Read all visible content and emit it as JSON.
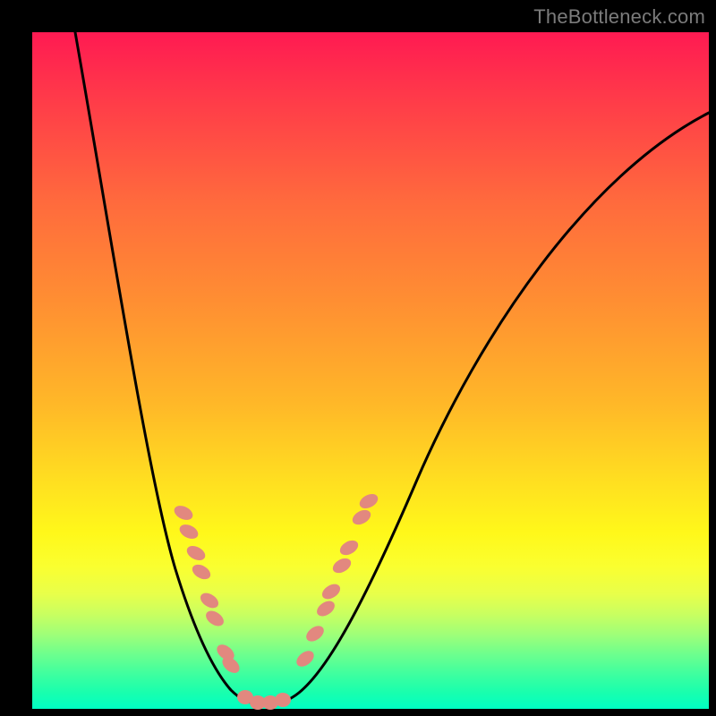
{
  "watermark": "TheBottleneck.com",
  "colors": {
    "frame": "#000000",
    "curve": "#000000",
    "dots": "#e2887f",
    "gradient_top": "#ff1a52",
    "gradient_mid": "#ffe120",
    "gradient_bottom": "#00ffc3",
    "watermark_text": "#7b7b7b"
  },
  "chart_data": {
    "type": "line",
    "title": "",
    "xlabel": "",
    "ylabel": "",
    "xlim": [
      0,
      100
    ],
    "ylim": [
      0,
      100
    ],
    "grid": false,
    "legend": "none",
    "note": "V-shaped bottleneck curve over a vertical red→yellow→green gradient. 100 = top (worst / red), 0 = bottom (best / green). X and Y values estimated from pixel positions; no axis ticks are printed in the source image.",
    "series": [
      {
        "name": "bottleneck-curve",
        "x": [
          6,
          12,
          17,
          21,
          25,
          28,
          30,
          32,
          34,
          36,
          38,
          40,
          44,
          50,
          57,
          65,
          75,
          85,
          95,
          100
        ],
        "y": [
          100,
          78,
          58,
          40,
          25,
          14,
          6,
          2,
          1,
          1,
          2,
          5,
          12,
          25,
          40,
          55,
          70,
          80,
          86,
          88
        ]
      },
      {
        "name": "highlighted-points",
        "style": "salmon-dots",
        "x": [
          22.4,
          23.1,
          24.2,
          25.0,
          26.2,
          27.0,
          28.6,
          29.4,
          31.5,
          33.3,
          35.2,
          37.0,
          40.3,
          41.8,
          43.4,
          44.2,
          45.8,
          46.8,
          48.7,
          49.7
        ],
        "y": [
          29.0,
          26.2,
          23.0,
          20.2,
          16.0,
          13.4,
          8.3,
          6.5,
          1.7,
          0.9,
          0.9,
          1.3,
          7.4,
          11.1,
          14.8,
          17.3,
          21.2,
          23.8,
          28.3,
          30.7
        ]
      }
    ]
  }
}
